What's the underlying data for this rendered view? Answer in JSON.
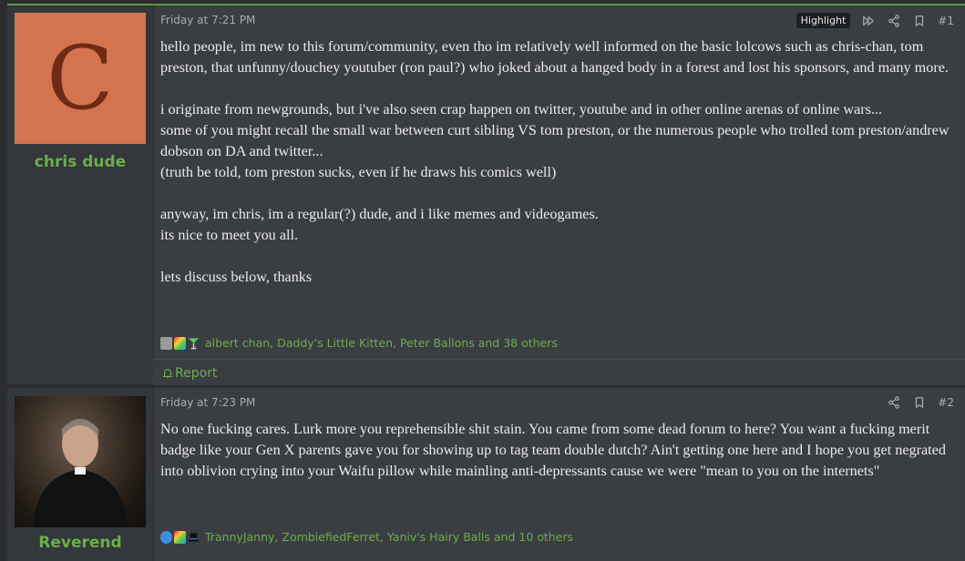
{
  "posts": [
    {
      "avatar_letter": "C",
      "username": "chris dude",
      "time": "Friday at 7:21 PM",
      "highlight_label": "Highlight",
      "post_number": "#1",
      "body": "hello people, im new to this forum/community, even tho im relatively well informed on the basic lolcows such as chris-chan, tom preston, that unfunny/douchey youtuber (ron paul?) who joked about a hanged body in a forest and lost his sponsors, and many more.\n\ni originate from newgrounds, but i've also seen crap happen on twitter, youtube and in other online arenas of online wars...\nsome of you might recall the small war between curt sibling VS tom preston, or the numerous people who trolled tom preston/andrew dobson on DA and twitter...\n(truth be told, tom preston sucks, even if he draws his comics well)\n\nanyway, im chris, im a regular(?) dude, and i like memes and videogames.\nits nice to meet you all.\n\nlets discuss below, thanks",
      "reaction_users": "albert chan, Daddy's Little Kitten, Peter Ballons and 38 others",
      "reaction_icons": [
        "trash-icon",
        "puzzle-icon",
        "cocktail-icon"
      ],
      "report_label": "Report"
    },
    {
      "username": "Reverend",
      "time": "Friday at 7:23 PM",
      "post_number": "#2",
      "body": "No one fucking cares. Lurk more you reprehensible shit stain. You came from some dead forum to here? You want a fucking merit badge like your Gen X parents gave you for showing up to tag team double dutch? Ain't getting one here and I hope you get negrated into oblivion crying into your Waifu pillow while mainling anti-depressants cause we were \"mean to you on the internets\"",
      "reaction_users": "TrannyJanny, ZombiefiedFerret, Yaniv's Hairy Balls and 10 others",
      "reaction_icons": [
        "thumbs-up-icon",
        "puzzle-icon",
        "top-hat-icon"
      ]
    }
  ],
  "colors": {
    "accent_green": "#6aaf4a",
    "avatar_bg": "#d4744f",
    "avatar_letter": "#6e2a14",
    "post_bg": "#3a3d42",
    "page_bg": "#2a2c30"
  }
}
